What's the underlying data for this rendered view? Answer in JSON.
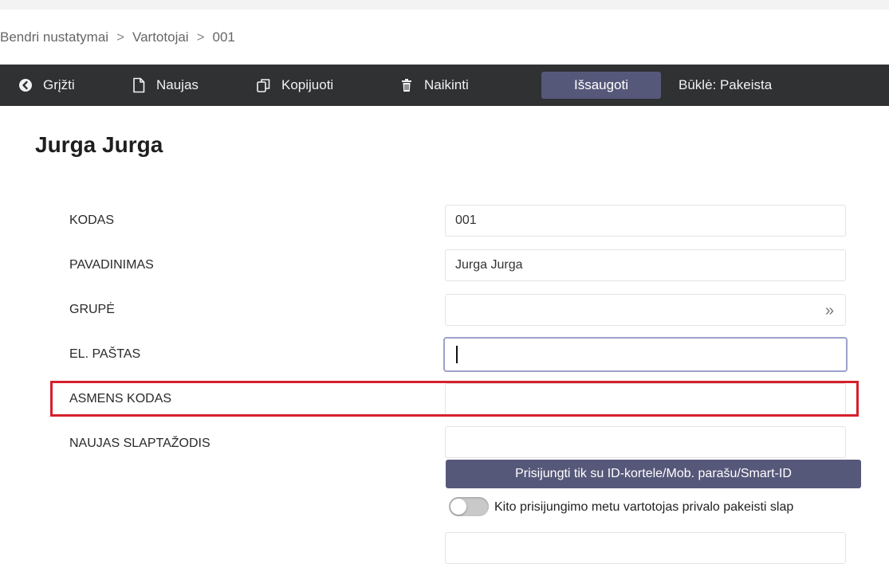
{
  "breadcrumb": {
    "items": [
      "Bendri nustatymai",
      "Vartotojai",
      "001"
    ],
    "separator": ">"
  },
  "toolbar": {
    "back_label": "Grįžti",
    "new_label": "Naujas",
    "copy_label": "Kopijuoti",
    "delete_label": "Naikinti",
    "save_label": "Išsaugoti",
    "status_text": "Būklė: Pakeista"
  },
  "icons": {
    "back": "arrow-left-circle-icon",
    "new": "document-icon",
    "copy": "copy-icon",
    "delete": "trash-icon",
    "group_picker": "double-chevron-right-icon"
  },
  "page": {
    "title": "Jurga Jurga"
  },
  "form": {
    "kodas": {
      "label": "KODAS",
      "value": "001"
    },
    "pavadinimas": {
      "label": "PAVADINIMAS",
      "value": "Jurga Jurga"
    },
    "grupe": {
      "label": "GRUPĖ",
      "value": ""
    },
    "el_pastas": {
      "label": "EL. PAŠTAS",
      "value": ""
    },
    "asmens_kodas": {
      "label": "ASMENS KODAS",
      "value": ""
    },
    "naujas_slaptazodis": {
      "label": "NAUJAS SLAPTAŽODIS",
      "value": ""
    },
    "id_login_button": "Prisijungti tik su ID-kortele/Mob. parašu/Smart-ID",
    "change_password_toggle": {
      "label": "Kito prisijungimo metu vartotojas privalo pakeisti slap",
      "on": false
    }
  },
  "colors": {
    "toolbar_bg": "#2f3133",
    "button_bg": "#56587a",
    "highlight": "#d6202c",
    "focus_border": "#9da1cc"
  }
}
